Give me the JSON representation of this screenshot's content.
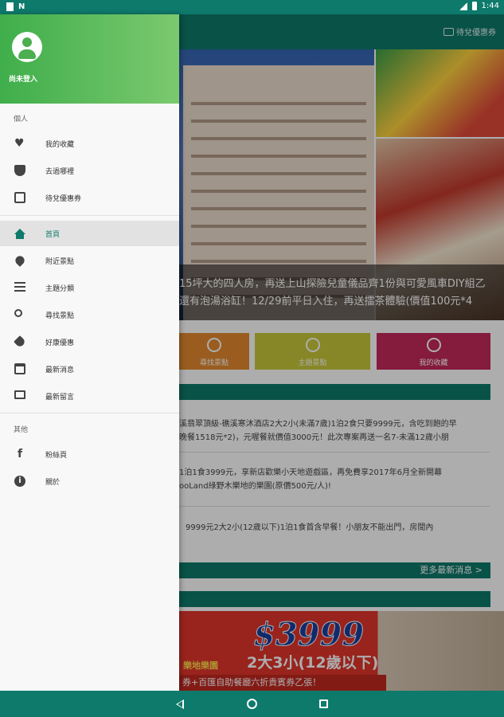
{
  "status_bar": {
    "time": "1:44",
    "left_indicator": "N"
  },
  "app_bar": {
    "coupon_label": "待兌優惠券"
  },
  "hero": {
    "caption_line1": "15坪大的四人房，再送上山探險兒童儀品齊1份與可愛風車DIY組乙",
    "caption_line2": "還有泡湯浴缸！12/29前平日入住，再送擂茶體驗(價值100元*4"
  },
  "tiles": [
    {
      "label": "尋找景點"
    },
    {
      "label": "主題景點"
    },
    {
      "label": "我的收藏"
    }
  ],
  "news": [
    {
      "text_l1": "溪翡翠頂級-礁溪寒沐酒店2大2小(未滿7歲)1泊2食只要9999元，含吃到飽的早",
      "text_l2": "晚餐1518元*2)，元喔餐就價值3000元！此次專案再送一名7-未滿12歲小朋"
    },
    {
      "text_l1": "1泊1食3999元，享新店歡樂小天地遊戲區，再免費享2017年6月全新開幕",
      "text_l2": "ooLand綠野木樂地的樂園(原價500元/人)!"
    },
    {
      "text_l1": "9999元2大2小(12歲以下)1泊1食首含早餐！小朋友不能出門，房間內",
      "text_l2": ""
    }
  ],
  "more_news_label": "更多最新消息 >",
  "banner": {
    "price": "$3999",
    "subtitle": "2大3小(12歲以下)",
    "left_text": "樂地樂園",
    "strip_text": "券+百匯自助餐廳六折貴賓券乙張！"
  },
  "drawer": {
    "login_label": "尚未登入",
    "group_personal": "個人",
    "personal_items": [
      {
        "label": "我的收藏"
      },
      {
        "label": "去過哪裡"
      },
      {
        "label": "待兌優惠券"
      }
    ],
    "main_items": [
      {
        "label": "首頁"
      },
      {
        "label": "附近景點"
      },
      {
        "label": "主題分類"
      },
      {
        "label": "尋找景點"
      },
      {
        "label": "好康優惠"
      },
      {
        "label": "最新消息"
      },
      {
        "label": "最新留言"
      }
    ],
    "group_other": "其他",
    "other_items": [
      {
        "label": "粉絲頁"
      },
      {
        "label": "關於"
      }
    ]
  },
  "colors": {
    "primary": "#0e7a6b",
    "header_green": "#3fae4b",
    "active_bg": "#e2e2e2"
  }
}
